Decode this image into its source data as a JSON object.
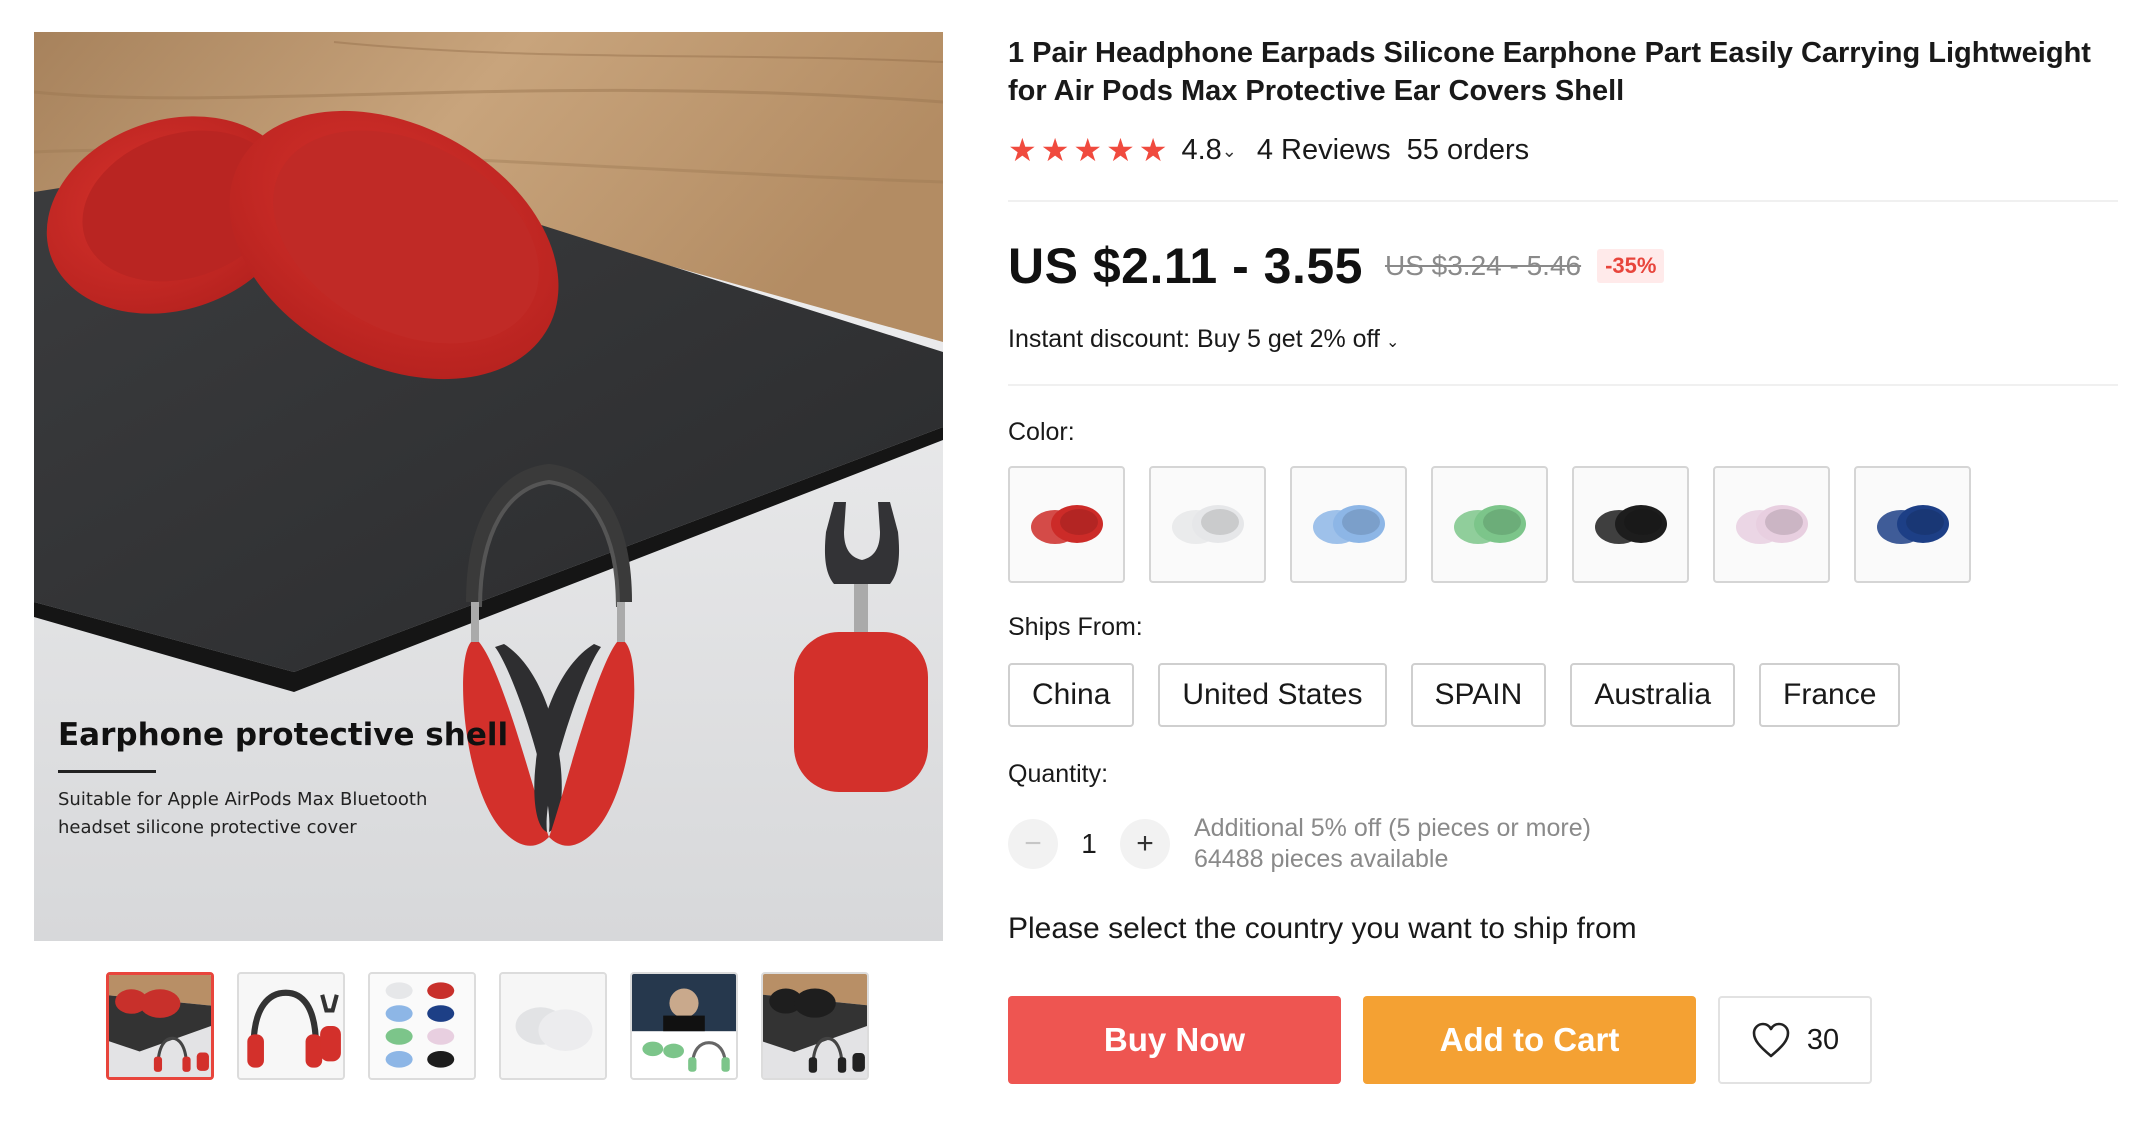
{
  "product": {
    "title": "1 Pair Headphone Earpads Silicone Earphone Part Easily Carrying Lightweight for Air Pods Max Protective Ear Covers Shell",
    "rating": "4.8",
    "star_count": 5,
    "reviews": "4 Reviews",
    "orders": "55 orders"
  },
  "gallery": {
    "image_title": "Earphone protective shell",
    "image_subtitle": "Suitable for Apple AirPods Max Bluetooth headset silicone protective cover",
    "thumbnail_count": 6,
    "active_thumbnail": 1
  },
  "pricing": {
    "price": "US $2.11 - 3.55",
    "original_price": "US $3.24 - 5.46",
    "discount": "-35%",
    "instant_discount": "Instant discount: Buy 5 get 2% off"
  },
  "color": {
    "label": "Color:",
    "options": [
      "#cc2b28",
      "#e6e7e9",
      "#8db6e6",
      "#7cc58a",
      "#1d1d1d",
      "#e8cfe0",
      "#1d3f86"
    ]
  },
  "shipping": {
    "label": "Ships From:",
    "options": [
      "China",
      "United States",
      "SPAIN",
      "Australia",
      "France"
    ],
    "prompt": "Please select the country you want to ship from"
  },
  "quantity": {
    "label": "Quantity:",
    "value": "1",
    "minus": "−",
    "plus": "+",
    "additional_discount": "Additional 5% off (5 pieces or more)",
    "available": "64488 pieces available"
  },
  "actions": {
    "buy_now": "Buy Now",
    "add_to_cart": "Add to Cart",
    "wishlist_count": "30"
  },
  "colors": {
    "accent": "#ee5551",
    "cart": "#f4a133",
    "star": "#f04a3e"
  }
}
